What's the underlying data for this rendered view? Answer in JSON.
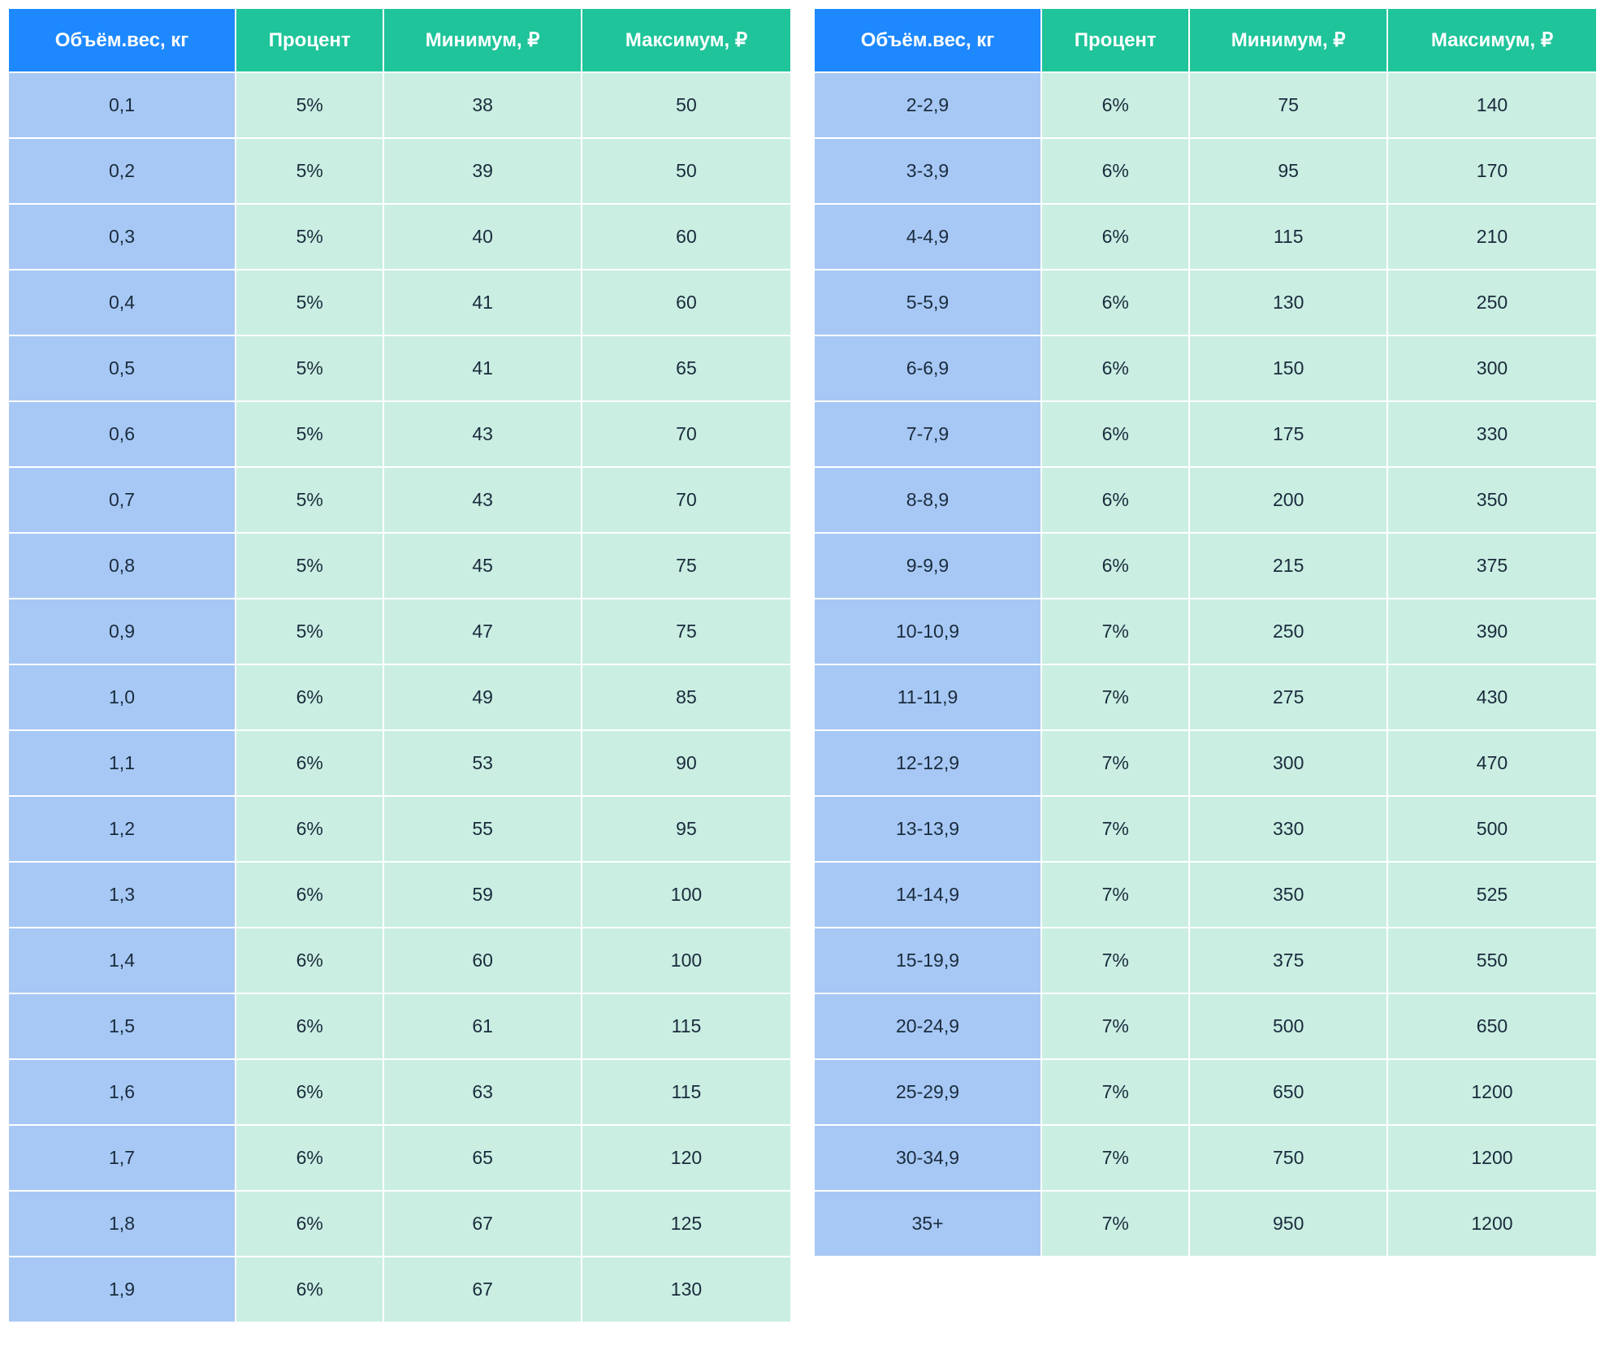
{
  "headers": [
    "Объём.вес, кг",
    "Процент",
    "Минимум, ₽",
    "Максимум, ₽"
  ],
  "left_rows": [
    [
      "0,1",
      "5%",
      "38",
      "50"
    ],
    [
      "0,2",
      "5%",
      "39",
      "50"
    ],
    [
      "0,3",
      "5%",
      "40",
      "60"
    ],
    [
      "0,4",
      "5%",
      "41",
      "60"
    ],
    [
      "0,5",
      "5%",
      "41",
      "65"
    ],
    [
      "0,6",
      "5%",
      "43",
      "70"
    ],
    [
      "0,7",
      "5%",
      "43",
      "70"
    ],
    [
      "0,8",
      "5%",
      "45",
      "75"
    ],
    [
      "0,9",
      "5%",
      "47",
      "75"
    ],
    [
      "1,0",
      "6%",
      "49",
      "85"
    ],
    [
      "1,1",
      "6%",
      "53",
      "90"
    ],
    [
      "1,2",
      "6%",
      "55",
      "95"
    ],
    [
      "1,3",
      "6%",
      "59",
      "100"
    ],
    [
      "1,4",
      "6%",
      "60",
      "100"
    ],
    [
      "1,5",
      "6%",
      "61",
      "115"
    ],
    [
      "1,6",
      "6%",
      "63",
      "115"
    ],
    [
      "1,7",
      "6%",
      "65",
      "120"
    ],
    [
      "1,8",
      "6%",
      "67",
      "125"
    ],
    [
      "1,9",
      "6%",
      "67",
      "130"
    ]
  ],
  "right_rows": [
    [
      "2-2,9",
      "6%",
      "75",
      "140"
    ],
    [
      "3-3,9",
      "6%",
      "95",
      "170"
    ],
    [
      "4-4,9",
      "6%",
      "115",
      "210"
    ],
    [
      "5-5,9",
      "6%",
      "130",
      "250"
    ],
    [
      "6-6,9",
      "6%",
      "150",
      "300"
    ],
    [
      "7-7,9",
      "6%",
      "175",
      "330"
    ],
    [
      "8-8,9",
      "6%",
      "200",
      "350"
    ],
    [
      "9-9,9",
      "6%",
      "215",
      "375"
    ],
    [
      "10-10,9",
      "7%",
      "250",
      "390"
    ],
    [
      "11-11,9",
      "7%",
      "275",
      "430"
    ],
    [
      "12-12,9",
      "7%",
      "300",
      "470"
    ],
    [
      "13-13,9",
      "7%",
      "330",
      "500"
    ],
    [
      "14-14,9",
      "7%",
      "350",
      "525"
    ],
    [
      "15-19,9",
      "7%",
      "375",
      "550"
    ],
    [
      "20-24,9",
      "7%",
      "500",
      "650"
    ],
    [
      "25-29,9",
      "7%",
      "650",
      "1200"
    ],
    [
      "30-34,9",
      "7%",
      "750",
      "1200"
    ],
    [
      "35+",
      "7%",
      "950",
      "1200"
    ]
  ]
}
